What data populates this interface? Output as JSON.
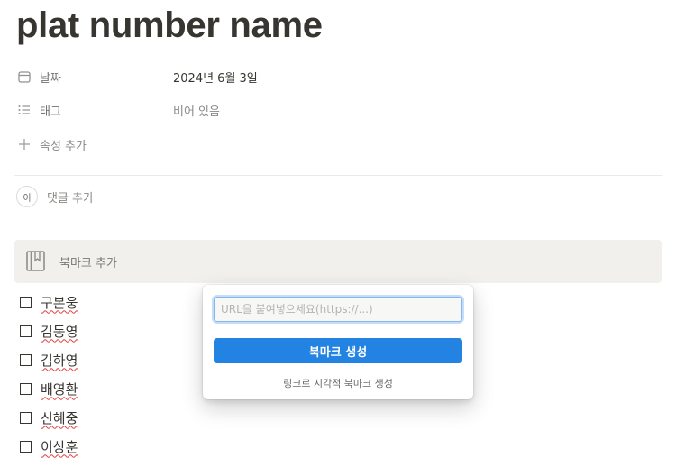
{
  "page": {
    "title": "plat number name"
  },
  "properties": [
    {
      "icon": "calendar-icon",
      "label": "날짜",
      "value": "2024년 6월 3일"
    },
    {
      "icon": "list-icon",
      "label": "태그",
      "value": "비어 있음"
    }
  ],
  "add_property_label": "속성 추가",
  "comment": {
    "avatar_text": "이",
    "placeholder": "댓글 추가"
  },
  "bookmark": {
    "label": "북마크 추가",
    "icon": "book-icon"
  },
  "todos": [
    {
      "text": "구본웅",
      "checked": false
    },
    {
      "text": "김동영",
      "checked": false
    },
    {
      "text": "김하영",
      "checked": false
    },
    {
      "text": "배영환",
      "checked": false
    },
    {
      "text": "신혜중",
      "checked": false
    },
    {
      "text": "이상훈",
      "checked": false
    }
  ],
  "popup": {
    "placeholder": "URL을 붙여넣으세요(https://...)",
    "value": "",
    "button_label": "북마크 생성",
    "hint": "링크로 시각적 북마크 생성"
  },
  "colors": {
    "accent": "#2383e2",
    "spellcheck": "#e03e3e"
  }
}
